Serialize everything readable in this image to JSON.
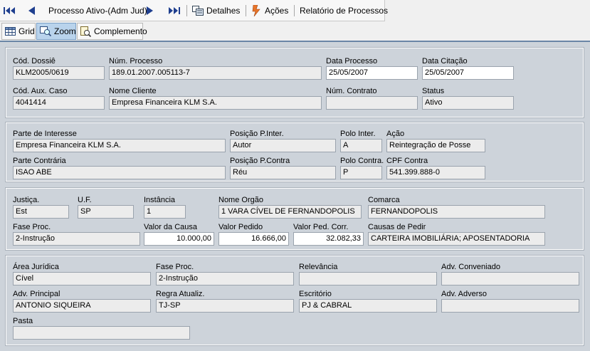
{
  "toolbar": {
    "process_label": "Processo Ativo-(Adm Jud)",
    "details_label": "Detalhes",
    "actions_label": "Ações",
    "report_label": "Relatório de Processos"
  },
  "tabs": [
    {
      "label": "Grid"
    },
    {
      "label": "Zoom"
    },
    {
      "label": "Complemento"
    }
  ],
  "section1": {
    "cod_dossie": {
      "label": "Cód. Dossiê",
      "value": "KLM2005/0619"
    },
    "num_processo": {
      "label": "Núm. Processo",
      "value": "189.01.2007.005113-7"
    },
    "data_processo": {
      "label": "Data Processo",
      "value": "25/05/2007"
    },
    "data_citacao": {
      "label": "Data Citação",
      "value": "25/05/2007"
    },
    "cod_aux_caso": {
      "label": "Cód. Aux. Caso",
      "value": "4041414"
    },
    "nome_cliente": {
      "label": "Nome Cliente",
      "value": "Empresa Financeira KLM S.A."
    },
    "num_contrato": {
      "label": "Núm. Contrato",
      "value": ""
    },
    "status": {
      "label": "Status",
      "value": "Ativo"
    }
  },
  "section2": {
    "parte_interesse": {
      "label": "Parte de Interesse",
      "value": "Empresa Financeira KLM S.A."
    },
    "posicao_inter": {
      "label": "Posição P.Inter.",
      "value": "Autor"
    },
    "polo_inter": {
      "label": "Polo Inter.",
      "value": "A"
    },
    "acao": {
      "label": "Ação",
      "value": "Reintegração de Posse"
    },
    "parte_contraria": {
      "label": "Parte Contrária",
      "value": "ISAO ABE"
    },
    "posicao_contra": {
      "label": "Posição P.Contra",
      "value": "Réu"
    },
    "polo_contra": {
      "label": "Polo Contra.",
      "value": "P"
    },
    "cpf_contra": {
      "label": "CPF Contra",
      "value": "541.399.888-0"
    }
  },
  "section3": {
    "justica": {
      "label": "Justiça.",
      "value": "Est"
    },
    "uf": {
      "label": "U.F.",
      "value": "SP"
    },
    "instancia": {
      "label": "Instância",
      "value": "1"
    },
    "nome_orgao": {
      "label": "Nome Orgão",
      "value": "1 VARA CÍVEL DE FERNANDOPOLIS"
    },
    "comarca": {
      "label": "Comarca",
      "value": "FERNANDOPOLIS"
    },
    "fase_proc": {
      "label": "Fase Proc.",
      "value": "2-Instrução"
    },
    "valor_causa": {
      "label": "Valor da Causa",
      "value": "10.000,00"
    },
    "valor_pedido": {
      "label": "Valor Pedido",
      "value": "16.666,00"
    },
    "valor_ped_corr": {
      "label": "Valor Ped. Corr.",
      "value": "32.082,33"
    },
    "causas_pedir": {
      "label": "Causas de Pedir",
      "value": "CARTEIRA IMOBILIÁRIA; APOSENTADORIA"
    }
  },
  "section4": {
    "area_juridica": {
      "label": "Área Jurídica",
      "value": "Cível"
    },
    "fase_proc": {
      "label": "Fase Proc.",
      "value": "2-Instrução"
    },
    "relevancia": {
      "label": "Relevância",
      "value": ""
    },
    "adv_conveniado": {
      "label": "Adv. Conveniado",
      "value": ""
    },
    "adv_principal": {
      "label": "Adv. Principal",
      "value": "ANTONIO SIQUEIRA"
    },
    "regra_atualiz": {
      "label": "Regra Atualiz.",
      "value": "TJ-SP"
    },
    "escritorio": {
      "label": "Escritório",
      "value": "PJ & CABRAL"
    },
    "adv_adverso": {
      "label": "Adv. Adverso",
      "value": ""
    },
    "pasta": {
      "label": "Pasta",
      "value": ""
    }
  }
}
